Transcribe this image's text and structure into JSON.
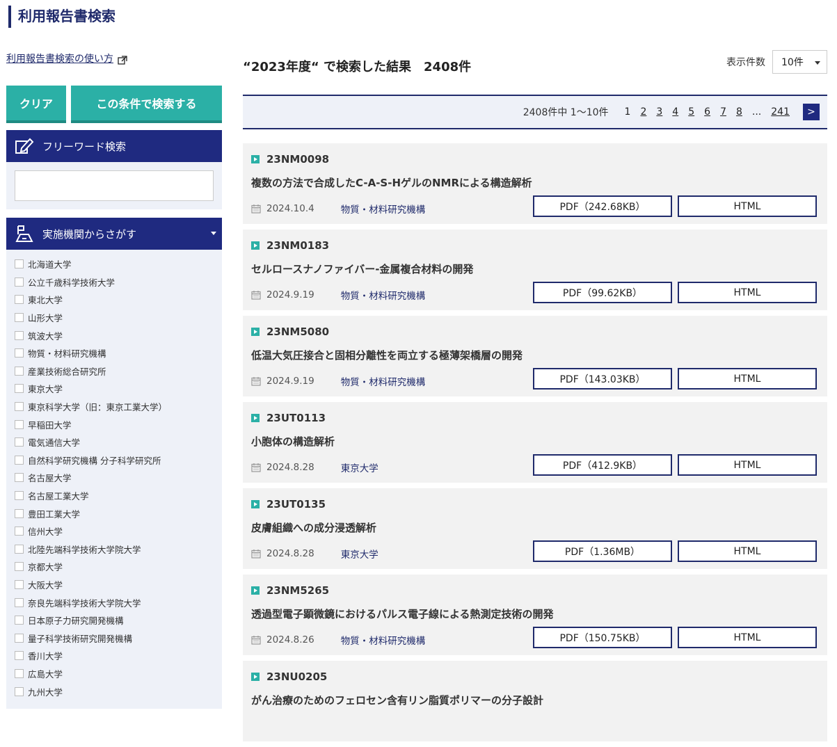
{
  "page_title": "利用報告書検索",
  "sidebar": {
    "howto_link": "利用報告書検索の使い方",
    "clear_label": "クリア",
    "search_label": "この条件で検索する",
    "freeword_label": "フリーワード検索",
    "freeword_value": "",
    "institution_label": "実施機関からさがす",
    "institutions": [
      "北海道大学",
      "公立千歳科学技術大学",
      "東北大学",
      "山形大学",
      "筑波大学",
      "物質・材料研究機構",
      "産業技術総合研究所",
      "東京大学",
      "東京科学大学（旧：東京工業大学）",
      "早稲田大学",
      "電気通信大学",
      "自然科学研究機構 分子科学研究所",
      "名古屋大学",
      "名古屋工業大学",
      "豊田工業大学",
      "信州大学",
      "北陸先端科学技術大学院大学",
      "京都大学",
      "大阪大学",
      "奈良先端科学技術大学院大学",
      "日本原子力研究開発機構",
      "量子科学技術研究開発機構",
      "香川大学",
      "広島大学",
      "九州大学"
    ]
  },
  "main": {
    "result_title": "“2023年度“ で検索した結果　2408件",
    "per_page_label": "表示件数",
    "per_page_value": "10件",
    "pager": {
      "summary": "2408件中 1～10件",
      "pages": [
        "1",
        "2",
        "3",
        "4",
        "5",
        "6",
        "7",
        "8"
      ],
      "ellipsis": "...",
      "last": "241",
      "next": ">"
    },
    "results": [
      {
        "id": "23NM0098",
        "title": "複数の方法で合成したC-A-S-HゲルのNMRによる構造解析",
        "date": "2024.10.4",
        "org": "物質・材料研究機構",
        "pdf": "PDF（242.68KB）",
        "html": "HTML"
      },
      {
        "id": "23NM0183",
        "title": "セルロースナノファイバー-金属複合材料の開発",
        "date": "2024.9.19",
        "org": "物質・材料研究機構",
        "pdf": "PDF（99.62KB）",
        "html": "HTML"
      },
      {
        "id": "23NM5080",
        "title": "低温大気圧接合と固相分離性を両立する極薄架橋層の開発",
        "date": "2024.9.19",
        "org": "物質・材料研究機構",
        "pdf": "PDF（143.03KB）",
        "html": "HTML"
      },
      {
        "id": "23UT0113",
        "title": "小胞体の構造解析",
        "date": "2024.8.28",
        "org": "東京大学",
        "pdf": "PDF（412.9KB）",
        "html": "HTML"
      },
      {
        "id": "23UT0135",
        "title": "皮膚組織への成分浸透解析",
        "date": "2024.8.28",
        "org": "東京大学",
        "pdf": "PDF（1.36MB）",
        "html": "HTML"
      },
      {
        "id": "23NM5265",
        "title": "透過型電子顕微鏡におけるパルス電子線による熱測定技術の開発",
        "date": "2024.8.26",
        "org": "物質・材料研究機構",
        "pdf": "PDF（150.75KB）",
        "html": "HTML"
      },
      {
        "id": "23NU0205",
        "title": "がん治療のためのフェロセン含有リン脂質ポリマーの分子設計",
        "date": "",
        "org": "",
        "pdf": "",
        "html": ""
      }
    ]
  }
}
